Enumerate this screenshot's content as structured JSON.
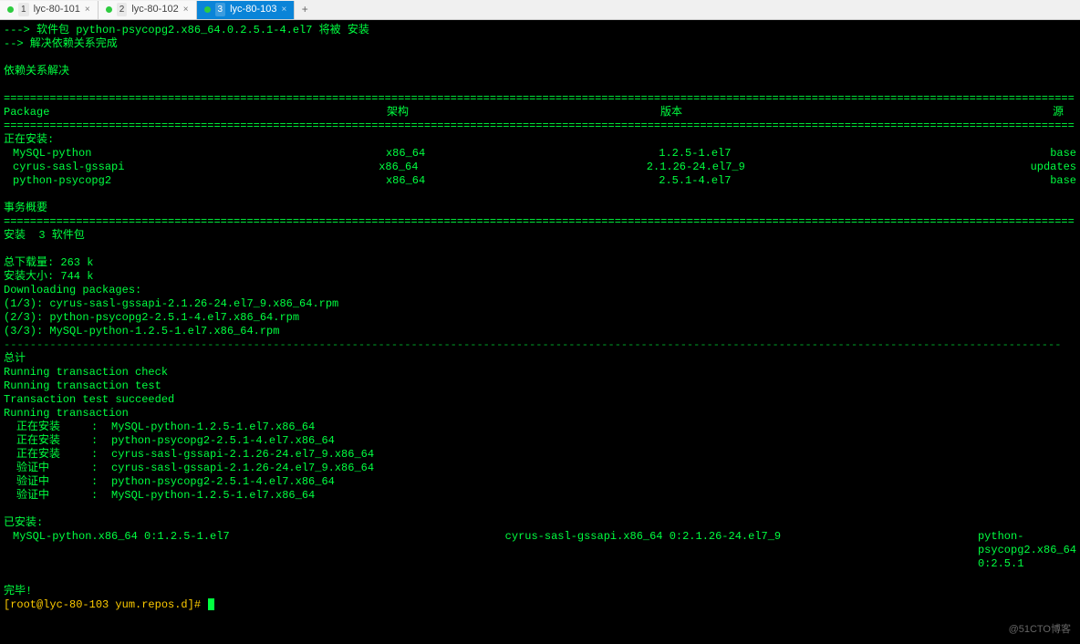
{
  "tabs": [
    {
      "num": "1",
      "label": "lyc-80-101"
    },
    {
      "num": "2",
      "label": "lyc-80-102"
    },
    {
      "num": "3",
      "label": "lyc-80-103"
    }
  ],
  "intro": {
    "l1": "---> 软件包 python-psycopg2.x86_64.0.2.5.1-4.el7 将被 安装",
    "l2": "--> 解决依赖关系完成",
    "l3": "依赖关系解决"
  },
  "headers": {
    "pkg": " Package",
    "arch": "架构",
    "ver": "版本",
    "src": "源"
  },
  "installHead": "正在安装:",
  "packages": [
    {
      "name": "MySQL-python",
      "arch": "x86_64",
      "ver": "1.2.5-1.el7",
      "src": "base"
    },
    {
      "name": "cyrus-sasl-gssapi",
      "arch": "x86_64",
      "ver": "2.1.26-24.el7_9",
      "src": "updates"
    },
    {
      "name": "python-psycopg2",
      "arch": "x86_64",
      "ver": "2.5.1-4.el7",
      "src": "base"
    }
  ],
  "txSummary": "事务概要",
  "installCount": "安装  3 软件包",
  "dlsize": "总下载量: 263 k",
  "instsize": "安装大小: 744 k",
  "dlHead": "Downloading packages:",
  "downloads": [
    "(1/3): cyrus-sasl-gssapi-2.1.26-24.el7_9.x86_64.rpm",
    "(2/3): python-psycopg2-2.5.1-4.el7.x86_64.rpm",
    "(3/3): MySQL-python-1.2.5-1.el7.x86_64.rpm"
  ],
  "total": "总计",
  "run": [
    "Running transaction check",
    "Running transaction test",
    "Transaction test succeeded",
    "Running transaction"
  ],
  "transSteps": [
    {
      "act": "正在安装",
      "pkg": "MySQL-python-1.2.5-1.el7.x86_64"
    },
    {
      "act": "正在安装",
      "pkg": "python-psycopg2-2.5.1-4.el7.x86_64"
    },
    {
      "act": "正在安装",
      "pkg": "cyrus-sasl-gssapi-2.1.26-24.el7_9.x86_64"
    },
    {
      "act": "验证中",
      "pkg": "cyrus-sasl-gssapi-2.1.26-24.el7_9.x86_64"
    },
    {
      "act": "验证中",
      "pkg": "python-psycopg2-2.5.1-4.el7.x86_64"
    },
    {
      "act": "验证中",
      "pkg": "MySQL-python-1.2.5-1.el7.x86_64"
    }
  ],
  "installedHead": "已安装:",
  "installed": [
    "MySQL-python.x86_64 0:1.2.5-1.el7",
    "cyrus-sasl-gssapi.x86_64 0:2.1.26-24.el7_9",
    "python-psycopg2.x86_64 0:2.5.1"
  ],
  "done": "完毕!",
  "prompt": {
    "pre": "[root@lyc-80-103 yum.repos.d]# "
  },
  "watermark": "@51CTO博客",
  "hrEq": "===================================================================================================================================================================",
  "hrDash": "-----------------------------------------------------------------------------------------------------------------------------------------------------------------"
}
